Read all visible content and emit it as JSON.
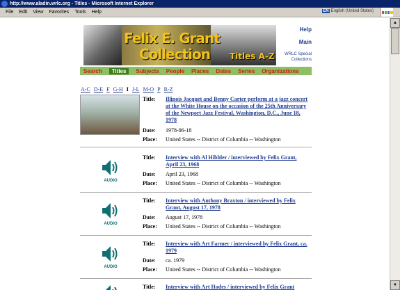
{
  "window": {
    "title": "http://www.aladin.wrlc.org - Titles - Microsoft Internet Explorer",
    "menu": [
      "File",
      "Edit",
      "View",
      "Favorites",
      "Tools",
      "Help"
    ],
    "language_badge": "EN",
    "language_text": "English (United States)"
  },
  "banner": {
    "title_line1": "Felix E. Grant",
    "title_line2": "Collection",
    "subtitle": "Titles A-Z"
  },
  "side_links": {
    "help": "Help",
    "main": "Main",
    "wrlc_line1": "WRLC Special",
    "wrlc_line2": "Collections"
  },
  "nav": [
    "Search",
    "Titles",
    "Subjects",
    "People",
    "Places",
    "Dates",
    "Series",
    "Organizations"
  ],
  "alpha_index": [
    "A-C",
    "D-E",
    "F",
    "G-H",
    "I",
    "J-L",
    "M-O",
    "P",
    "R-Z"
  ],
  "labels": {
    "title": "Title:",
    "date": "Date:",
    "place": "Place:",
    "audio": "AUDIO"
  },
  "records": [
    {
      "title": "Illinois Jacquet and Benny Carter perform at a jazz concert at the White House on the occasion of the 25th Anniversary of the Newport Jazz Festival, Washington, D.C., June 18, 1978",
      "date": "1978-06-18",
      "place": "United States -- District of Columbia -- Washington"
    },
    {
      "title": "Interview with Al Hibbler / interviewed by Felix Grant, April 23, 1968",
      "date": "April 23, 1968",
      "place": "United States -- District of Columbia -- Washington"
    },
    {
      "title": "Interview with Anthony Braxton / interviewed by Felix Grant, August 17, 1978",
      "date": "August 17, 1978",
      "place": "United States -- District of Columbia -- Washington"
    },
    {
      "title": "Interview with Art Farmer / interviewed by Felix Grant, ca. 1979",
      "date": "ca. 1979",
      "place": "United States -- District of Columbia -- Washington"
    },
    {
      "title": "Interview with Art Hodes / interviewed by Felix Grant"
    }
  ]
}
